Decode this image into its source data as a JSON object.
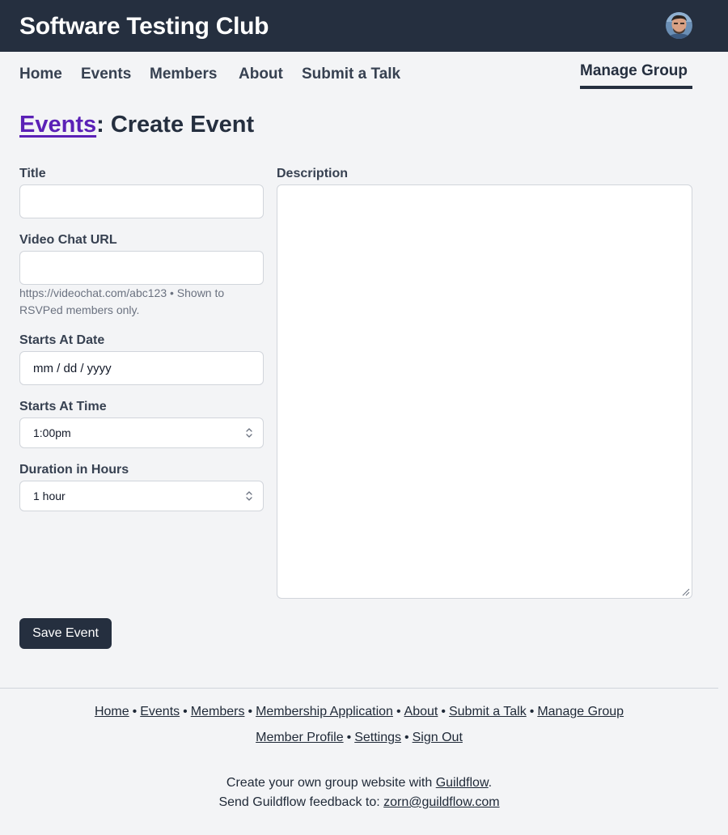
{
  "header": {
    "site_title": "Software Testing Club",
    "avatar_icon": "user-avatar"
  },
  "nav": {
    "items": [
      "Home",
      "Events",
      "Members",
      "About",
      "Submit a Talk"
    ],
    "active": "Manage Group"
  },
  "page": {
    "breadcrumb_link": "Events",
    "title_rest": ": Create Event"
  },
  "form": {
    "title_label": "Title",
    "title_value": "",
    "video_label": "Video Chat URL",
    "video_value": "",
    "video_hint": "https://videochat.com/abc123 • Shown to RSVPed members only.",
    "date_label": "Starts At Date",
    "date_placeholder": "mm / dd / yyyy",
    "time_label": "Starts At Time",
    "time_value": "1:00pm",
    "duration_label": "Duration in Hours",
    "duration_value": "1 hour",
    "description_label": "Description",
    "description_value": "",
    "save_label": "Save Event"
  },
  "footer": {
    "links_row1": [
      "Home",
      "Events",
      "Members",
      "Membership Application",
      "About",
      "Submit a Talk",
      "Manage Group"
    ],
    "links_row2": [
      "Member Profile",
      "Settings",
      "Sign Out"
    ],
    "cta_prefix": "Create your own group website with ",
    "cta_link": "Guildflow",
    "cta_suffix": ".",
    "feedback_prefix": "Send Guildflow feedback to: ",
    "feedback_email": "zorn@guildflow.com"
  },
  "colors": {
    "topbar": "#252f3f",
    "link_accent": "#5b21b6",
    "background": "#f3f4f6"
  }
}
